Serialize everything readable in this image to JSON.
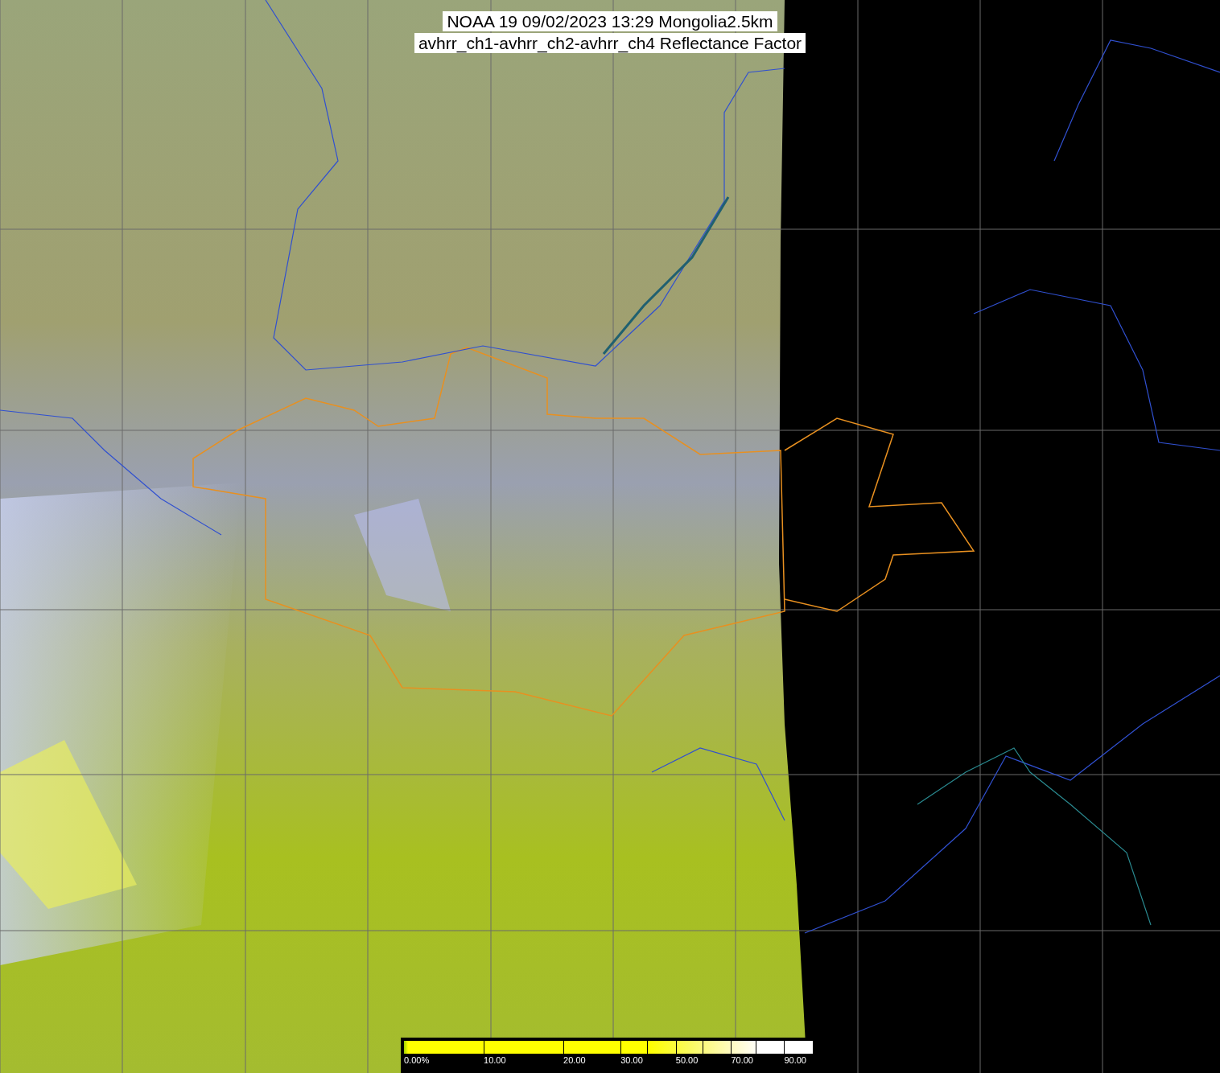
{
  "title": {
    "lines": [
      "NOAA 19 09/02/2023 13:29 Mongolia2.5km",
      "avhrr_ch1-avhrr_ch2-avhrr_ch4 Reflectance Factor"
    ]
  },
  "colorbar": {
    "labels": [
      "0.00%",
      "10.00",
      "20.00",
      "30.00",
      "50.00",
      "70.00",
      "90.00"
    ]
  }
}
